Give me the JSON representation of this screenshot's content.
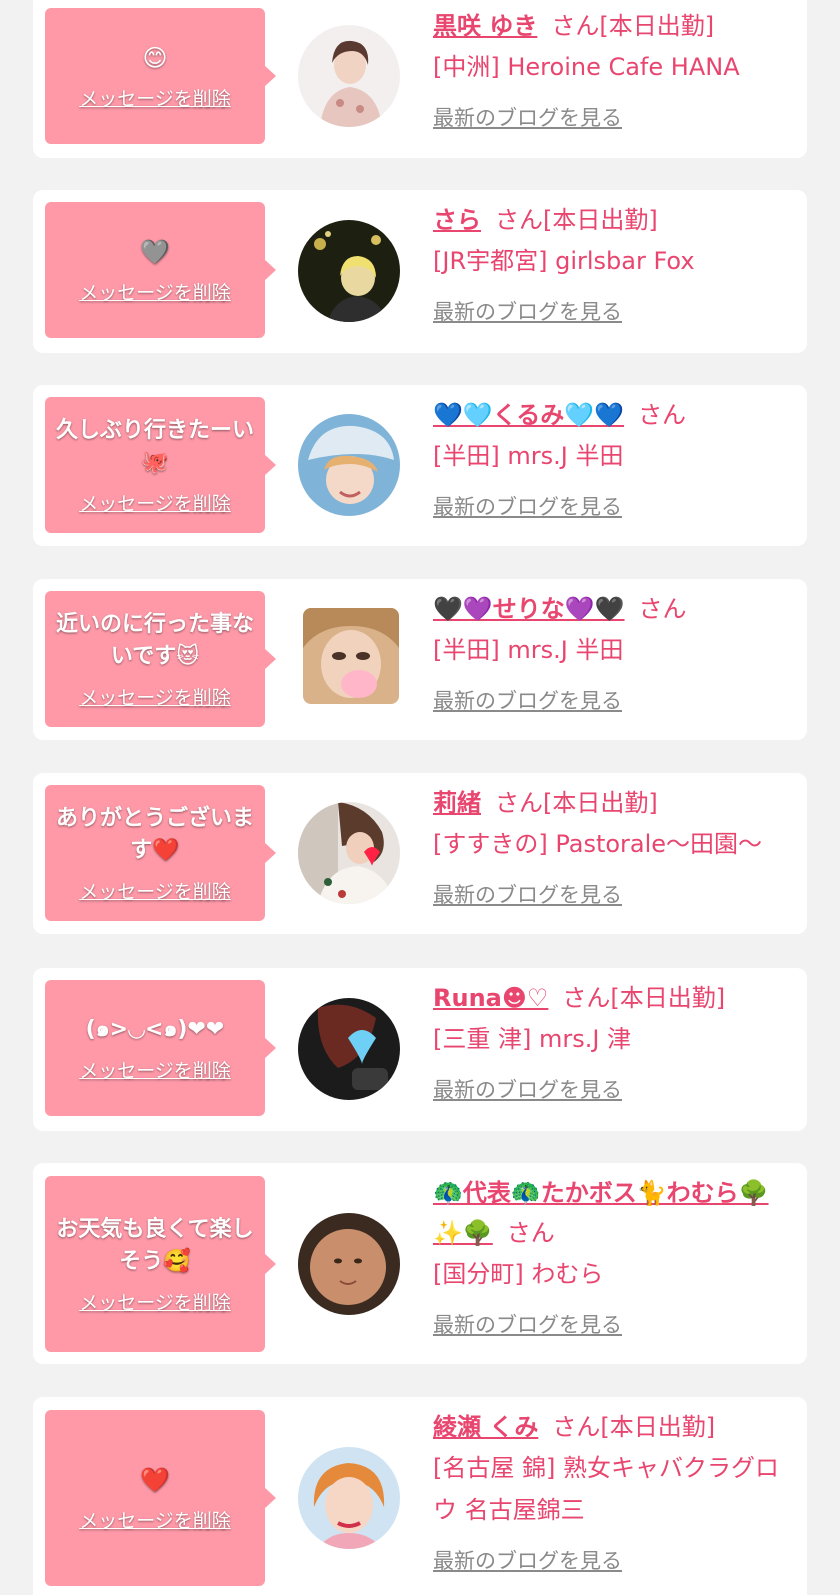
{
  "colors": {
    "background": "#f2f2f2",
    "card": "#ffffff",
    "bubble": "#ff99a8",
    "name_pink": "#e8456f",
    "link_gray": "#8a8a8a"
  },
  "delete_label": "メッセージを削除",
  "blog_label": "最新のブログを見る",
  "entries": [
    {
      "message": "😊",
      "name": "黒咲 ゆき",
      "suffix": "さん[本日出勤]",
      "shop": "[中洲] Heroine Cafe HANA"
    },
    {
      "message": "🩶",
      "name": "さら",
      "suffix": "さん[本日出勤]",
      "shop": "[JR宇都宮] girlsbar Fox"
    },
    {
      "message": "久しぶり行きたーい🐙",
      "name": "💙🩵くるみ🩵💙",
      "suffix": "さん",
      "shop": "[半田] mrs.J 半田"
    },
    {
      "message": "近いのに行った事ないです😻",
      "name": "🖤💜せりな💜🖤",
      "suffix": "さん",
      "shop": "[半田] mrs.J 半田"
    },
    {
      "message": "ありがとうございます❤️",
      "name": "莉緒",
      "suffix": "さん[本日出勤]",
      "shop": "[すすきの] Pastorale〜田園〜"
    },
    {
      "message": "(๑>◡<๑)❤❤",
      "name": "Runa☻♡",
      "suffix": "さん[本日出勤]",
      "shop": "[三重 津] mrs.J 津"
    },
    {
      "message": "お天気も良くて楽しそう🥰",
      "name": "🦚代表🦚たかボス🐈わむら🌳✨🌳",
      "suffix": "さん",
      "shop": "[国分町] わむら"
    },
    {
      "message": "❤️",
      "name": "綾瀬 くみ",
      "suffix": "さん[本日出勤]",
      "shop": "[名古屋 錦] 熟女キャバクラグロウ 名古屋錦三"
    }
  ]
}
